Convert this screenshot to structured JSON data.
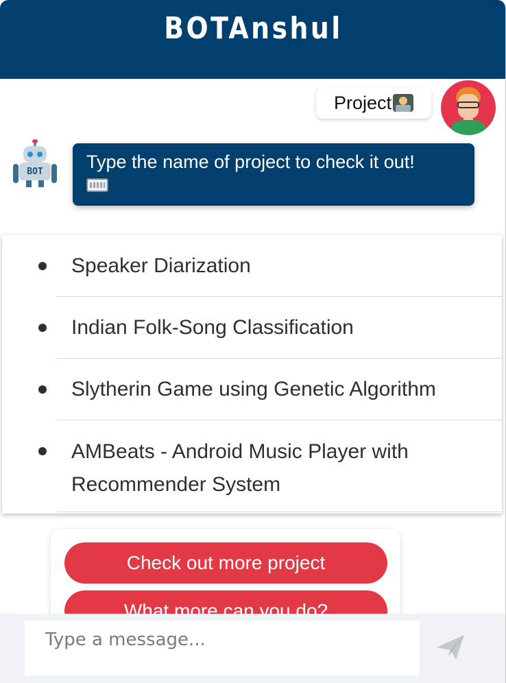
{
  "header": {
    "title": "BOTAnshul",
    "background": "#003f6e"
  },
  "conversation": {
    "user_message": {
      "text": "Project",
      "emoji": "technologist-emoji",
      "avatar": "user-avatar"
    },
    "bot_message": {
      "text": "Type the name of project to check it out!",
      "emoji": "keyboard-emoji",
      "avatar": "robot-bot-avatar",
      "background": "#003f6e"
    },
    "projects": [
      "Speaker Diarization",
      "Indian Folk-Song Classification",
      "Slytherin Game using Genetic Algorithm",
      "AMBeats - Android Music Player with Recommender System"
    ],
    "quick_replies": [
      "Check out more project",
      "What more can you do?"
    ],
    "quick_reply_color": "#e33947"
  },
  "composer": {
    "placeholder": "Type a message...",
    "send_icon": "paper-plane-icon"
  }
}
